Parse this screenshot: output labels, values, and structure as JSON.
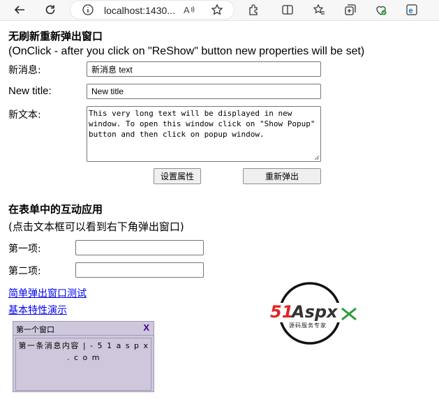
{
  "browser": {
    "url": "localhost:1430..."
  },
  "section1": {
    "title": "无刷新重新弹出窗口",
    "subtitle": "(OnClick - after you click on \"ReShow\" button new properties will be set)",
    "message_label": "新消息:",
    "message_value": "新消息 text",
    "newtitle_label": "New title:",
    "newtitle_value": "New title",
    "text_label": "新文本:",
    "text_value": "This very long text will be displayed in new window. To open this window click on \"Show Popup\" button and then click on popup window.",
    "set_button": "设置属性",
    "reshow_button": "重新弹出"
  },
  "section2": {
    "title": "在表单中的互动应用",
    "subtitle": "(点击文本框可以看到右下角弹出窗口)",
    "item1_label": "第一项:",
    "item1_value": "",
    "item2_label": "第二项:",
    "item2_value": ""
  },
  "links": {
    "simple_popup": "简单弹出窗口测试",
    "basic_features": "基本特性演示"
  },
  "popup": {
    "title": "第一个窗口",
    "close": "X",
    "content": "第一条消息内容 | - 5 1 a s p x . c o m"
  },
  "logo": {
    "brand_51": "51",
    "brand_aspx": "Aspx",
    "tagline": "源码服务专家"
  },
  "colors": {
    "popup_bg": "#cfc8dd",
    "link": "#0000ee",
    "logo_red": "#e02525",
    "logo_green": "#2a9d3a"
  }
}
